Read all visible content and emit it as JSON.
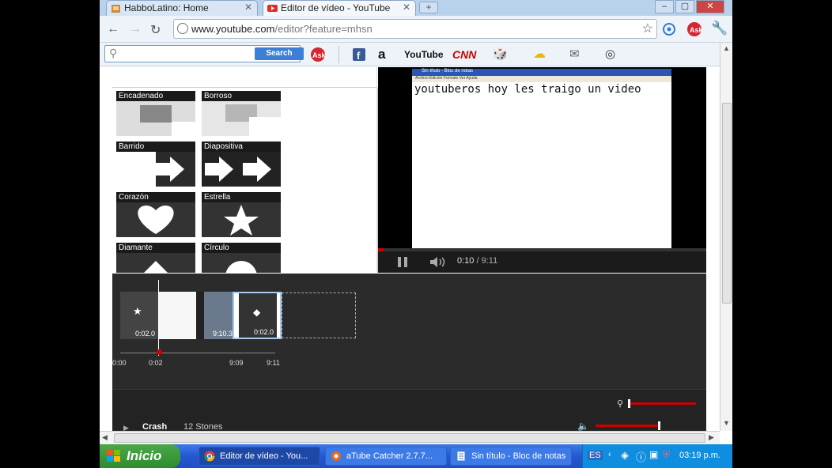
{
  "browser": {
    "tabs": [
      {
        "label": "HabboLatino: Home"
      },
      {
        "label": "Editor de vídeo - YouTube"
      }
    ],
    "new_tab_label": "+",
    "url_host": "www.youtube.com",
    "url_path": "/editor?feature=mhsn",
    "ask_search_button": "Search",
    "ask_brand": "Ask",
    "toolbar_youtube": "YouTube",
    "toolbar_cnn": "CNN"
  },
  "transitions": [
    {
      "label": "Encadenado"
    },
    {
      "label": "Borroso"
    },
    {
      "label": "Barrido"
    },
    {
      "label": "Diapositiva"
    },
    {
      "label": "Corazón"
    },
    {
      "label": "Estrella"
    },
    {
      "label": "Diamante"
    },
    {
      "label": "Círculo"
    }
  ],
  "video": {
    "notepad_title": "Sin título - Bloc de notas",
    "notepad_menu": "Archivo  Edición  Formato  Ver  Ayuda",
    "notepad_text": "youtuberos hoy les traigo un video",
    "time_current": "0:10",
    "time_separator": "/",
    "time_total": "9:11",
    "progress_fraction": 0.018
  },
  "timeline": {
    "clips": [
      {
        "duration": "0:02.0"
      },
      {
        "duration": "9:10.3"
      },
      {
        "duration": "0:02.0"
      }
    ],
    "ticks": [
      "0:00",
      "0:02",
      "9:09",
      "9:11"
    ]
  },
  "lower": {
    "track_label": "Crash",
    "track_count": "12 Stones"
  },
  "taskbar": {
    "start_label": "Inicio",
    "tasks": [
      {
        "label": "Editor de vídeo - You..."
      },
      {
        "label": "aTube Catcher 2.7.7..."
      },
      {
        "label": "Sin título - Bloc de notas"
      }
    ],
    "lang": "ES",
    "clock": "03:19 p.m."
  },
  "colors": {
    "youtube_red": "#cc0000",
    "taskbar_blue": "#2458d0",
    "start_green": "#2e8b2e"
  }
}
